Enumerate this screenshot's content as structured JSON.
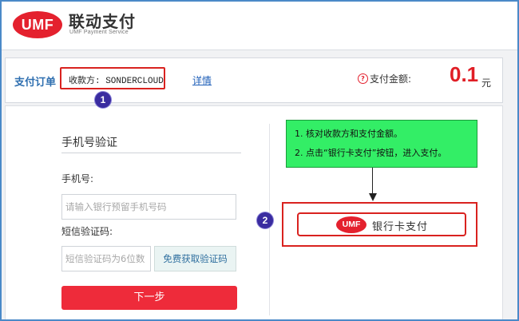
{
  "header": {
    "logo_text": "UMF",
    "brand_name": "联动支付",
    "brand_sub": "UMF Payment Service"
  },
  "order": {
    "label": "支付订单",
    "payee_text": "收款方: SONDERCLOUD",
    "detail_link": "详情",
    "help_icon_glyph": "?",
    "amount_label": "支付金额:",
    "amount_value": "0.1",
    "amount_unit": "元"
  },
  "badges": {
    "one": "1",
    "two": "2"
  },
  "verify": {
    "section_title": "手机号验证",
    "phone_label": "手机号:",
    "phone_placeholder": "请输入银行预留手机号码",
    "sms_label": "短信验证码:",
    "sms_placeholder": "短信验证码为6位数",
    "sms_button": "免费获取验证码",
    "next_button": "下一步"
  },
  "callout": {
    "line1": "1. 核对收款方和支付金额。",
    "line2": "2. 点击“银行卡支付”按钮，进入支付。"
  },
  "bank_pay": {
    "logo_text": "UMF",
    "label": "银行卡支付"
  },
  "colors": {
    "brand_red": "#e4212e",
    "link_blue": "#1f5fb8",
    "callout_green": "#33ee66",
    "badge_purple": "#3a2ca0"
  }
}
